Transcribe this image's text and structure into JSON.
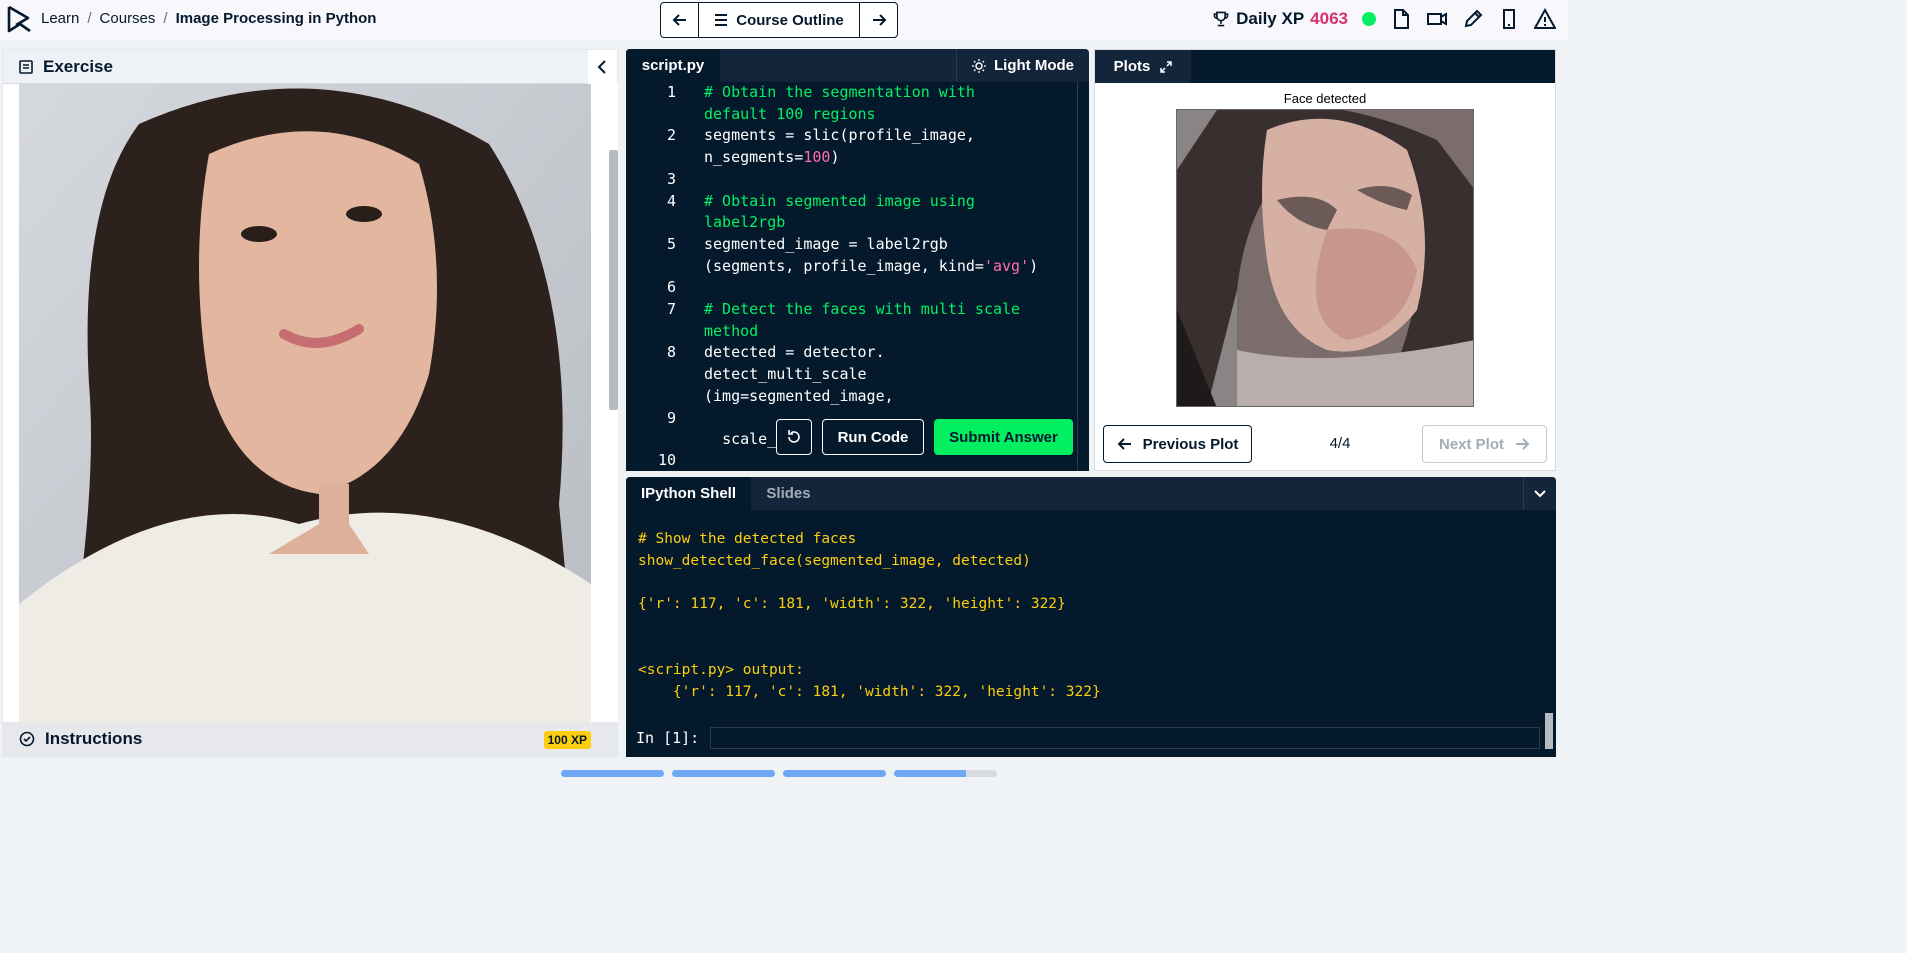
{
  "breadcrumb": {
    "items": [
      "Learn",
      "Courses"
    ],
    "separator": "/",
    "current": "Image Processing in Python"
  },
  "course_outline": {
    "label": "Course Outline"
  },
  "header": {
    "xp_label": "Daily XP",
    "xp_value": "4063"
  },
  "exercise": {
    "title": "Exercise",
    "instructions_label": "Instructions",
    "xp_badge": "100 XP"
  },
  "editor": {
    "tab": "script.py",
    "mode_label": "Light Mode",
    "lines": [
      {
        "n": "1",
        "segs": [
          {
            "t": "# Obtain the segmentation with\ndefault 100 regions",
            "c": "cm"
          }
        ]
      },
      {
        "n": "2",
        "segs": [
          {
            "t": "segments = slic(profile_image,\nn_segments=",
            "c": ""
          },
          {
            "t": "100",
            "c": "num"
          },
          {
            "t": ")",
            "c": ""
          }
        ]
      },
      {
        "n": "3",
        "segs": [
          {
            "t": "",
            "c": ""
          }
        ]
      },
      {
        "n": "4",
        "segs": [
          {
            "t": "# Obtain segmented image using\nlabel2rgb",
            "c": "cm"
          }
        ]
      },
      {
        "n": "5",
        "segs": [
          {
            "t": "segmented_image = label2rgb\n(segments, profile_image, kind=",
            "c": ""
          },
          {
            "t": "'avg'",
            "c": "str"
          },
          {
            "t": ")",
            "c": ""
          }
        ]
      },
      {
        "n": "6",
        "segs": [
          {
            "t": "",
            "c": ""
          }
        ]
      },
      {
        "n": "7",
        "segs": [
          {
            "t": "# Detect the faces with multi scale\nmethod",
            "c": "cm"
          }
        ]
      },
      {
        "n": "8",
        "segs": [
          {
            "t": "detected = detector.\ndetect_multi_scale\n(img=segmented_image,",
            "c": ""
          }
        ]
      },
      {
        "n": "9",
        "segs": [
          {
            "t": "",
            "c": ""
          }
        ]
      },
      {
        "n": "",
        "segs": [
          {
            "t": "  scale_",
            "c": ""
          }
        ]
      },
      {
        "n": "10",
        "segs": [
          {
            "t": "",
            "c": ""
          }
        ]
      }
    ],
    "run_label": "Run Code",
    "submit_label": "Submit Answer"
  },
  "plots": {
    "tab": "Plots",
    "title": "Face detected",
    "prev_label": "Previous Plot",
    "next_label": "Next Plot",
    "counter": "4/4"
  },
  "shell": {
    "tab": "IPython Shell",
    "slides_tab": "Slides",
    "output": "# Show the detected faces\nshow_detected_face(segmented_image, detected)\n\n{'r': 117, 'c': 181, 'width': 322, 'height': 322}\n\n\n<script.py> output:\n    {'r': 117, 'c': 181, 'width': 322, 'height': 322}",
    "prompt": "In [1]:"
  },
  "colors": {
    "accent_green": "#03ef62",
    "xp_pink": "#d6316c",
    "navy": "#05192d",
    "shell_yellow": "#fcce0d"
  },
  "progress": {
    "segments": 4,
    "last_fill": 0.7
  }
}
